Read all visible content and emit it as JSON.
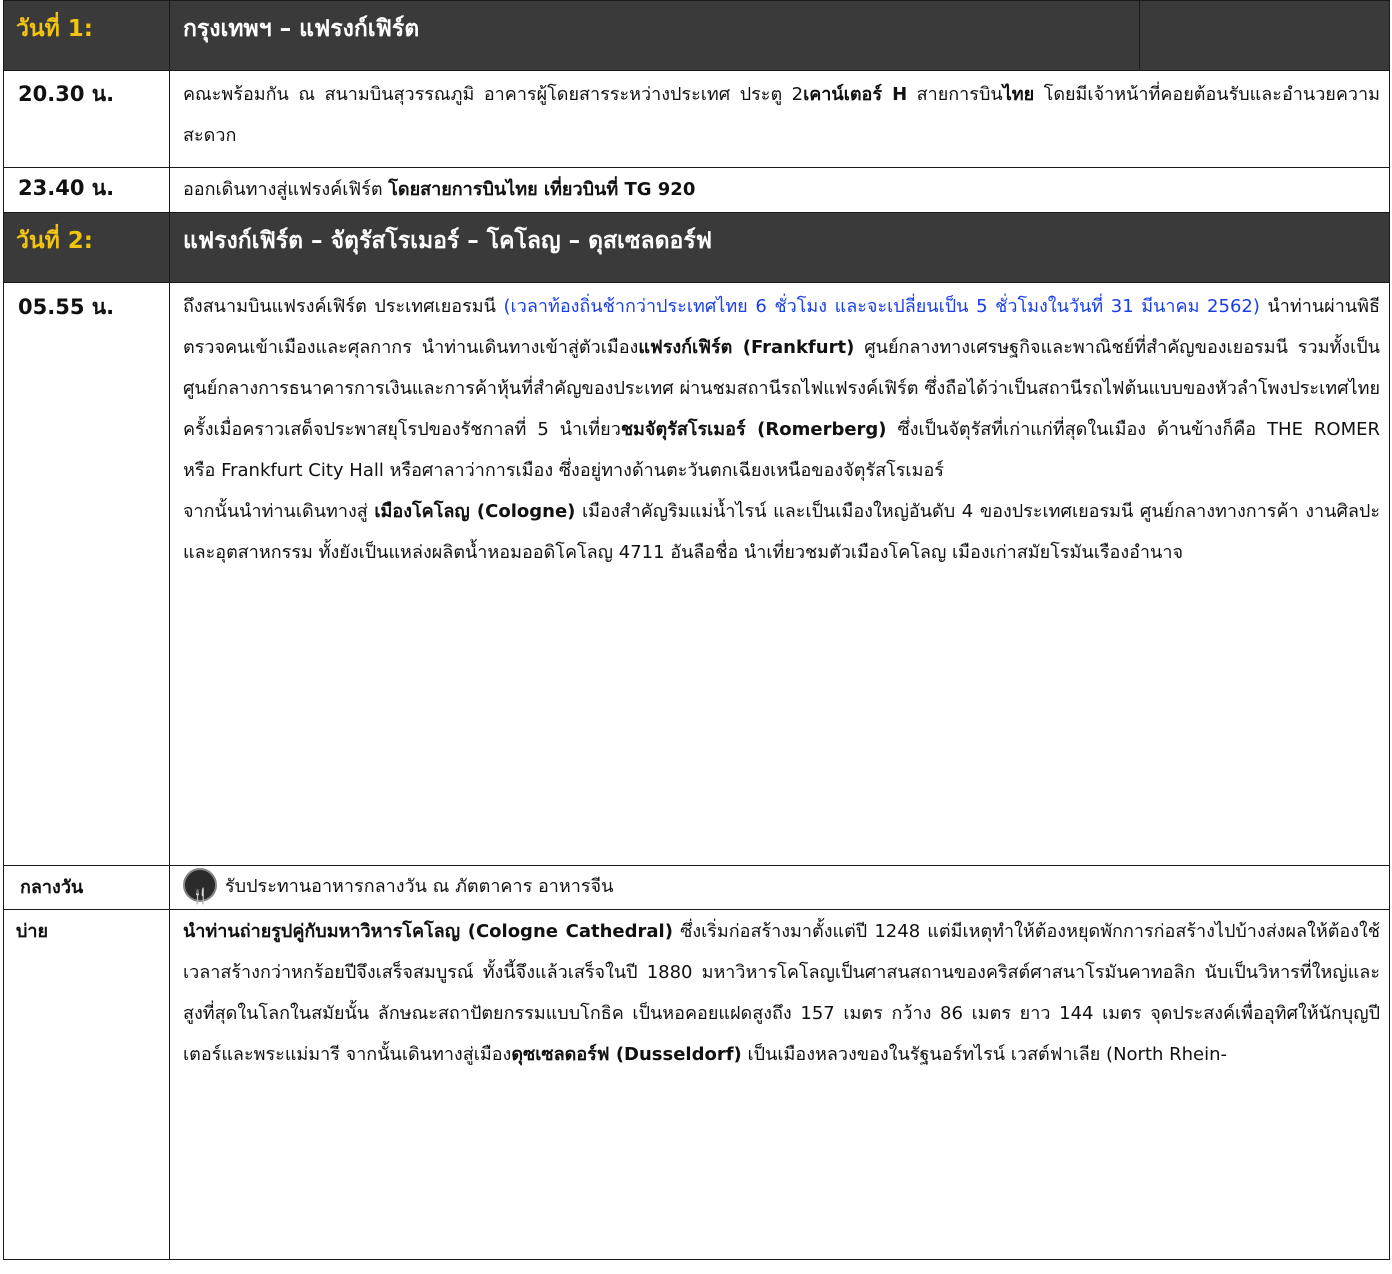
{
  "day1": {
    "label": "วันที่ 1:",
    "title": "กรุงเทพฯ – แฟรงก์เฟิร์ต",
    "rows": [
      {
        "time": "20.30 น.",
        "t1": "คณะพร้อมกัน ณ สนามบินสุวรรณภูมิ อาคารผู้โดยสารระหว่างประเทศ ประตู 2",
        "b1": "เคาน์เตอร์ H",
        "t2": " สายการบิน",
        "b2": "ไทย",
        "t3": " โดยมีเจ้าหน้าที่คอยต้อนรับและอำนวยความสะดวก"
      },
      {
        "time": "23.40 น.",
        "t1": "ออกเดินทางสู่แฟรงค์เฟิร์ต ",
        "b1": "โดยสายการบินไทย เที่ยวบินที่ TG 920"
      }
    ]
  },
  "day2": {
    "label": "วันที่ 2:",
    "title": "แฟรงก์เฟิร์ต – จัตุรัสโรเมอร์ – โคโลญ – ดุสเซลดอร์ฟ",
    "morning": {
      "time": "05.55 น.",
      "t1": "ถึงสนามบินแฟรงค์เฟิร์ต ประเทศเยอรมนี ",
      "blue": "(เวลาท้องถิ่นช้ากว่าประเทศไทย 6 ชั่วโมง และจะเปลี่ยนเป็น 5 ชั่วโมงในวันที่ 31 มีนาคม 2562)",
      "t2": " นำท่านผ่านพิธีตรวจคนเข้าเมืองและศุลกากร นำท่านเดินทางเข้าสู่ตัวเมือง",
      "b1": "แฟรงก์เฟิร์ต (Frankfurt)",
      "t3": " ศูนย์กลางทางเศรษฐกิจและพาณิชย์ที่สำคัญของเยอรมนี รวมทั้งเป็นศูนย์กลางการธนาคารการเงินและการค้าหุ้นที่สำคัญของประเทศ ผ่านชมสถานีรถไฟแฟรงค์เฟิร์ต ซึ่งถือได้ว่าเป็นสถานีรถไฟต้นแบบของหัวลำโพงประเทศไทย ครั้งเมื่อคราวเสด็จประพาสยุโรปของรัชกาลที่ 5 นำเที่ยว",
      "b2": "ชมจัตุรัสโรเมอร์ (Romerberg)",
      "t4": "  ซึ่งเป็นจัตุรัสที่เก่าแก่ที่สุดในเมือง ด้านข้างก็คือ THE ROMER หรือ Frankfurt City Hall หรือศาลาว่าการเมือง ซึ่งอยู่ทางด้านตะวันตกเฉียงเหนือของจัตุรัสโรเมอร์",
      "p2a": "จากนั้นนำท่านเดินทางสู่ ",
      "p2b": "เมืองโคโลญ (Cologne)",
      "p2c": " เมืองสำคัญริมแม่น้ำไรน์ และเป็นเมืองใหญ่อันดับ 4 ของประเทศเยอรมนี ศูนย์กลางทางการค้า งานศิลปะ และอุตสาหกรรม ทั้งยังเป็นแหล่งผลิตน้ำหอมออดิโคโลญ 4711 อันลือชื่อ นำเที่ยวชมตัวเมืองโคโลญ เมืองเก่าสมัยโรมันเรืองอำนาจ"
    },
    "lunch": {
      "time": "กลางวัน",
      "icon": "restaurant-icon",
      "text": "รับประทานอาหารกลางวัน ณ ภัตตาคาร อาหารจีน"
    },
    "afternoon": {
      "time": "บ่าย",
      "b1": "นำท่านถ่ายรูปคู่กับมหาวิหารโคโลญ (Cologne Cathedral)",
      "t1": " ซึ่งเริ่มก่อสร้างมาตั้งแต่ปี 1248 แต่มีเหตุทำให้ต้องหยุดพักการก่อสร้างไปบ้างส่งผลให้ต้องใช้เวลาสร้างกว่าหกร้อยปีจึงเสร็จสมบูรณ์ ทั้งนี้จึงแล้วเสร็จในปี 1880 มหาวิหารโคโลญเป็นศาสนสถานของคริสต์ศาสนาโรมันคาทอลิก นับเป็นวิหารที่ใหญ่และสูงที่สุดในโลกในสมัยนั้น ลักษณะสถาปัตยกรรมแบบโกธิค เป็นหอคอยแฝดสูงถึง 157 เมตร กว้าง 86 เมตร ยาว 144 เมตร จุดประสงค์เพื่ออุทิศให้นักบุญปีเตอร์และพระแม่มารี จากนั้นเดินทางสู่เมือง",
      "b2": "ดุซเซลดอร์ฟ (Dusseldorf)",
      "t2": " เป็นเมืองหลวงของในรัฐนอร์ทไรน์ เวสต์ฟาเลีย (North Rhein-"
    }
  },
  "colors": {
    "header_bg": "#3a3a3a",
    "day_label": "#f1c40f",
    "blue_text": "#1a3ee8"
  }
}
